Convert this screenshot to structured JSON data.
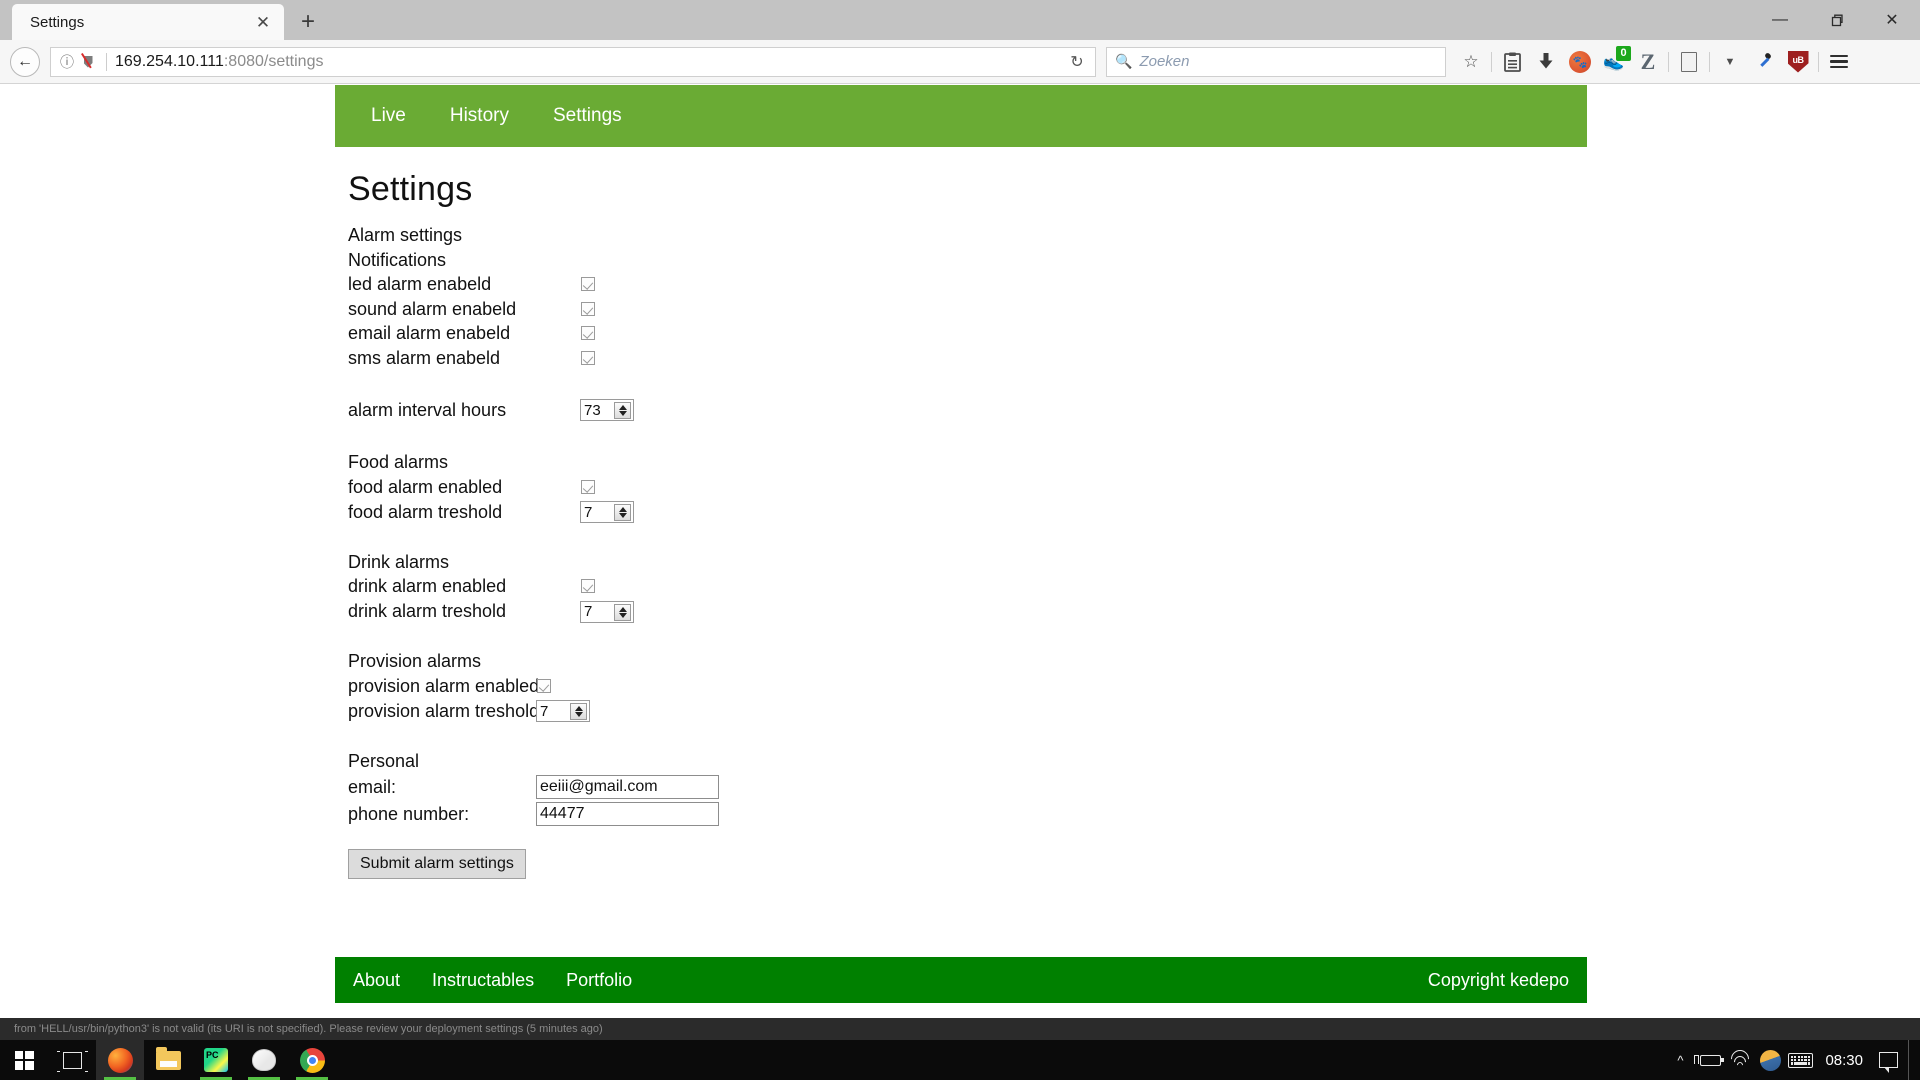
{
  "browser": {
    "tab": {
      "title": "Settings",
      "close_icon": "close-icon"
    },
    "newtab_icon": "plus-icon",
    "window_controls": {
      "minimize": "—",
      "restore": "❐",
      "close": "✕"
    },
    "back_icon": "back-arrow-icon",
    "identity_icon": "info-icon",
    "tracking_icon": "shield-slash-icon",
    "url": {
      "host": "169.254.10.111",
      "rest": ":8080/settings"
    },
    "reload_icon": "reload-icon",
    "search": {
      "placeholder": "Zoeken",
      "icon": "search-icon"
    },
    "toolbar": {
      "bookmark_star": "star-icon",
      "library": "library-icon",
      "downloads": "download-arrow-icon",
      "duckduckgo": "duckduckgo-icon",
      "shoe_extension": "shoe-icon",
      "shoe_badge": "0",
      "zotero": "Z",
      "document": "document-icon",
      "dropdown": "chevron-down-icon",
      "eyedropper": "eyedropper-icon",
      "ublock": "uB",
      "menu": "hamburger-menu-icon"
    }
  },
  "site": {
    "nav": [
      {
        "label": "Live"
      },
      {
        "label": "History"
      },
      {
        "label": "Settings"
      }
    ],
    "nav_color": "#6aab34",
    "footer_color": "#008000",
    "footer": {
      "links": [
        {
          "label": "About"
        },
        {
          "label": "Instructables"
        },
        {
          "label": "Portfolio"
        }
      ],
      "copyright": "Copyright kedepo"
    }
  },
  "page": {
    "title": "Settings",
    "sections": {
      "alarm": {
        "heading": "Alarm settings",
        "subheading": "Notifications",
        "checkboxes": [
          {
            "label": "led alarm enabeld",
            "checked": true
          },
          {
            "label": "sound alarm enabeld",
            "checked": true
          },
          {
            "label": "email alarm enabeld",
            "checked": true
          },
          {
            "label": "sms alarm enabeld",
            "checked": true
          }
        ],
        "interval": {
          "label": "alarm interval hours",
          "value": "73"
        }
      },
      "food": {
        "heading": "Food alarms",
        "enabled": {
          "label": "food alarm enabled",
          "checked": true
        },
        "threshold": {
          "label": "food alarm treshold",
          "value": "7"
        }
      },
      "drink": {
        "heading": "Drink alarms",
        "enabled": {
          "label": "drink alarm enabled",
          "checked": true
        },
        "threshold": {
          "label": "drink alarm treshold",
          "value": "7"
        }
      },
      "provision": {
        "heading": "Provision alarms",
        "enabled": {
          "label": "provision alarm enabled",
          "checked": true
        },
        "threshold": {
          "label": "provision alarm treshold",
          "value": "7"
        }
      },
      "personal": {
        "heading": "Personal",
        "email": {
          "label": "email:",
          "value": "eeiii@gmail.com"
        },
        "phone": {
          "label": "phone number:",
          "value": "44477"
        }
      }
    },
    "submit_label": "Submit alarm settings"
  },
  "background_window": {
    "text": "from 'HELL/usr/bin/python3' is not valid (its URI is not specified). Please review your deployment settings (5 minutes ago)"
  },
  "taskbar": {
    "start_icon": "windows-start-icon",
    "taskview_icon": "task-view-icon",
    "apps": [
      {
        "name": "firefox-icon"
      },
      {
        "name": "file-explorer-icon"
      },
      {
        "name": "pycharm-icon"
      },
      {
        "name": "paint-icon"
      },
      {
        "name": "chrome-icon"
      }
    ],
    "tray": {
      "overflow_icon": "chevron-up-icon",
      "battery_icon": "battery-charging-icon",
      "wifi_icon": "wifi-icon",
      "weather_icon": "weather-icon",
      "keyboard_icon": "keyboard-icon",
      "clock": "08:30",
      "notification_icon": "notification-icon"
    }
  }
}
